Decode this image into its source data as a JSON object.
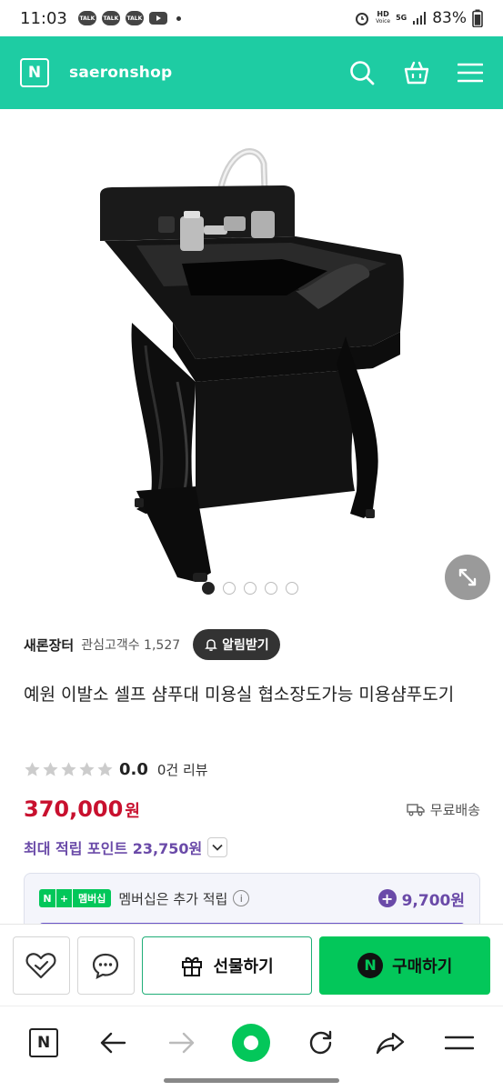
{
  "status_bar": {
    "time": "11:03",
    "notif_1": "TALK",
    "notif_2": "TALK",
    "notif_3": "TALK",
    "network_top": "HD",
    "network_bottom": "Voice",
    "network_5g": "5G",
    "battery": "83%"
  },
  "header": {
    "logo_letter": "N",
    "shop_name": "saeronshop"
  },
  "gallery": {
    "image_alt": "black shampoo station with chrome faucet",
    "page_count": 5,
    "current_page": 1
  },
  "seller": {
    "name": "새론장터",
    "fans_label": "관심고객수 1,527",
    "alarm_label": "알림받기"
  },
  "product": {
    "title": "예원 이발소 셀프 샴푸대 미용실 협소장도가능 미용샴푸도기",
    "rating": "0.0",
    "review_count": "0건 리뷰",
    "price": "370,000",
    "currency": "원",
    "shipping": "무료배송",
    "points_label": "최대 적립 포인트 23,750원"
  },
  "membership": {
    "badge_n": "N",
    "badge_plus": "+",
    "badge_label": "멤버십",
    "text": "멤버십은 추가 적립",
    "info": "i",
    "points": "9,700원"
  },
  "actions": {
    "gift_label": "선물하기",
    "buy_icon": "N",
    "buy_label": "구매하기"
  },
  "browser_nav": {
    "home_letter": "N"
  },
  "colors": {
    "brand_green": "#1ecca3",
    "naver_green": "#03c75a",
    "price_red": "#c8102e",
    "point_purple": "#6a4aa8"
  }
}
